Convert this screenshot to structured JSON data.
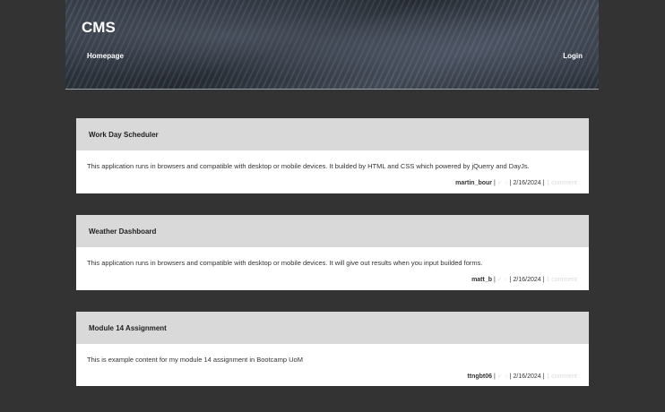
{
  "header": {
    "title": "CMS",
    "nav": {
      "home": "Homepage",
      "login": "Login"
    }
  },
  "posts": [
    {
      "title": "Work Day Scheduler",
      "content": "This application runs in browsers and compatible with desktop or mobile devices. It builded by HTML and CSS which powered by jQuerry and DayJs.",
      "author": "martin_bour",
      "sep1": "|",
      "actions": "✓ ○",
      "date": "| 2/16/2024 |",
      "comment": "1 comment"
    },
    {
      "title": "Weather Dashboard",
      "content": "This application runs in browsers and compatible with desktop or mobile devices. It will give out results when you input builded forms.",
      "author": "matt_b",
      "sep1": "|",
      "actions": "✓ ○",
      "date": "| 2/16/2024 |",
      "comment": "1 comment"
    },
    {
      "title": "Module 14 Assignment",
      "content": "This is example content for my module 14 assignment in Bootcamp UoM",
      "author": "ttngbt06",
      "sep1": "|",
      "actions": "✓ ○",
      "date": "| 2/16/2024 |",
      "comment": "1 comment"
    }
  ]
}
